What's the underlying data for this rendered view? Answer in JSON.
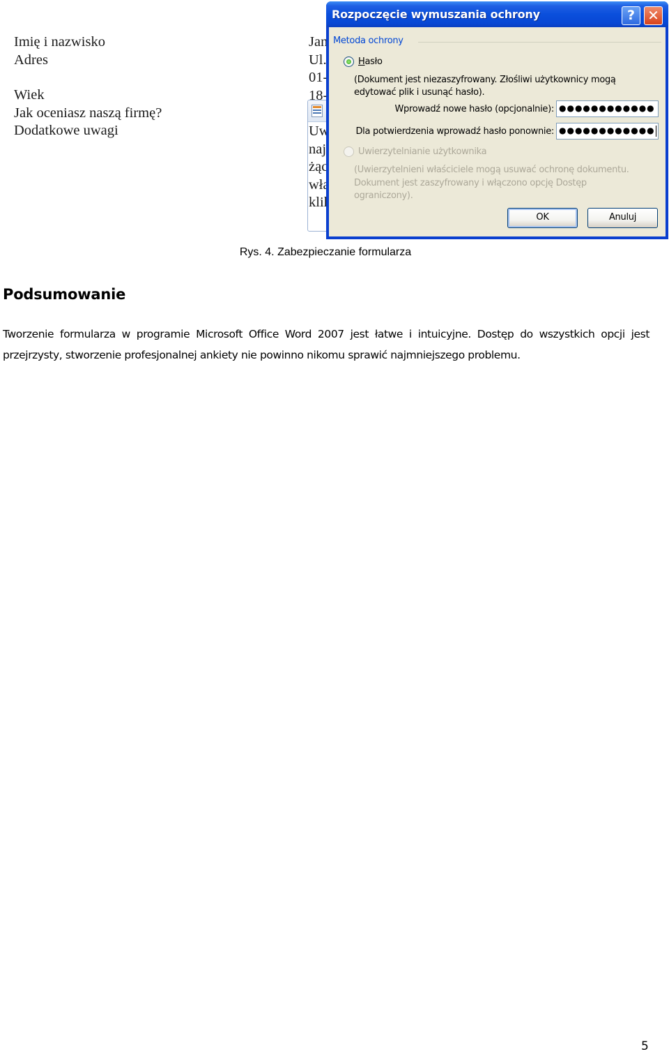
{
  "figure": {
    "form": {
      "labels": [
        "Imię i nazwisko",
        "Adres",
        "",
        "Wiek",
        "Jak oceniasz naszą firmę?",
        "Dodatkowe uwagi"
      ],
      "values_visible": [
        "Jan",
        "Ul.",
        "01-",
        "18-"
      ],
      "textbox_text_visible": [
        "Uw",
        "naj",
        "żąc",
        "wła",
        "klik"
      ]
    },
    "dialog": {
      "title": "Rozpoczęcie wymuszania ochrony",
      "help_button": "?",
      "close_button": "✕",
      "group_label": "Metoda ochrony",
      "option_password": {
        "label": "Hasło",
        "selected": true,
        "description": "(Dokument jest niezaszyfrowany. Złośliwi użytkownicy mogą edytować plik i usunąć hasło).",
        "new_password_label": "Wprowadź nowe hasło (opcjonalnie):",
        "new_password_value": "●●●●●●●●●●●●",
        "confirm_password_label": "Dla potwierdzenia wprowadź hasło ponownie:",
        "confirm_password_value": "●●●●●●●●●●●●"
      },
      "option_user_auth": {
        "label": "Uwierzytelnianie użytkownika",
        "selected": false,
        "enabled": false,
        "description": "(Uwierzytelnieni właściciele mogą usuwać ochronę dokumentu. Dokument jest zaszyfrowany i włączono opcję Dostęp ograniczony)."
      },
      "ok_label": "OK",
      "cancel_label": "Anuluj"
    },
    "caption": "Rys. 4. Zabezpieczanie formularza"
  },
  "section": {
    "heading": "Podsumowanie",
    "paragraph": "Tworzenie formularza w programie Microsoft Office Word 2007 jest łatwe i intuicyjne. Dostęp do wszystkich opcji jest przejrzysty, stworzenie profesjonalnej ankiety nie powinno nikomu sprawić najmniejszego problemu."
  },
  "page_number": "5"
}
